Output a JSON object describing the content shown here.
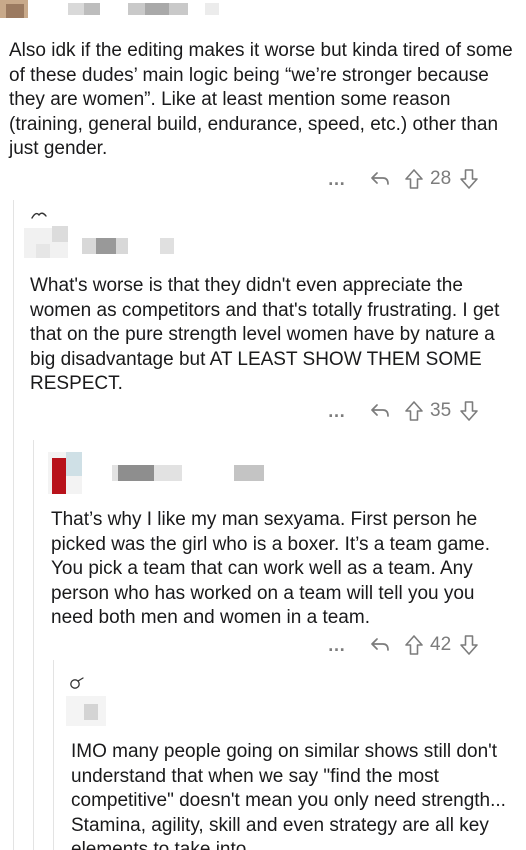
{
  "comments": [
    {
      "body": "Also idk if the editing makes it worse but kinda tired of some of these dudes’ main logic being “we’re stronger because they are women”. Like at least mention some reason (training, general build, endurance, speed, etc.) other than just gender.",
      "more": "…",
      "votes": "28"
    },
    {
      "body": "What's worse is that they didn't even appreciate the women as competitors and that's totally frustrating. I get that on the pure strength level women have by nature a big disadvantage but AT LEAST SHOW THEM SOME RESPECT.",
      "more": "…",
      "votes": "35"
    },
    {
      "body": "That’s why I like my man sexyama. First person he picked was the girl who is a boxer. It’s a team game. You pick a team that can work well as a team. Any person who has worked on a team will tell you you need both men and women in a team.",
      "more": "…",
      "votes": "42"
    },
    {
      "body": "IMO many people going on similar shows still don't understand that when we say \"find the most competitive\" doesn't mean you only need strength... Stamina, agility, skill and even strategy are all key elements to take into"
    }
  ],
  "colors": {
    "text": "#1a1a1b",
    "meta": "#7c7c7c",
    "thread_line": "#e3e3e3",
    "avatar_red": "#b8121b"
  },
  "icons": [
    "more-icon",
    "reply-icon",
    "upvote-icon",
    "downvote-icon",
    "avatar-icon"
  ]
}
